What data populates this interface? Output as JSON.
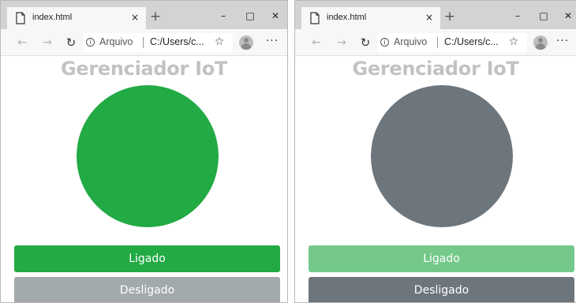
{
  "colors": {
    "on_active": "#22aa44",
    "on_inactive": "#74c98a",
    "off_active": "#6d757d",
    "off_inactive": "#a3aaad",
    "title_gray": "#c2c2c2"
  },
  "windows": [
    {
      "tab": {
        "title": "index.html",
        "close": "×",
        "new_tab": "+"
      },
      "controls": {
        "minimize": "–",
        "maximize": "□",
        "close": "✕"
      },
      "toolbar": {
        "back": "←",
        "forward": "→",
        "refresh": "↻",
        "info": "i",
        "site_label": "Arquivo",
        "url": "C:/Users/c...",
        "favorite": "☆",
        "more": "···"
      },
      "page": {
        "title": "Gerenciador IoT",
        "state": "on",
        "circle_color": "#22aa44",
        "on_button": {
          "label": "Ligado",
          "color": "#22aa44"
        },
        "off_button": {
          "label": "Desligado",
          "color": "#a3aaad"
        }
      }
    },
    {
      "tab": {
        "title": "index.html",
        "close": "×",
        "new_tab": "+"
      },
      "controls": {
        "minimize": "–",
        "maximize": "□",
        "close": "✕"
      },
      "toolbar": {
        "back": "←",
        "forward": "→",
        "refresh": "↻",
        "info": "i",
        "site_label": "Arquivo",
        "url": "C:/Users/c...",
        "favorite": "☆",
        "more": "···"
      },
      "page": {
        "title": "Gerenciador IoT",
        "state": "off",
        "circle_color": "#6d757d",
        "on_button": {
          "label": "Ligado",
          "color": "#74c98a"
        },
        "off_button": {
          "label": "Desligado",
          "color": "#6d757d"
        }
      }
    }
  ]
}
